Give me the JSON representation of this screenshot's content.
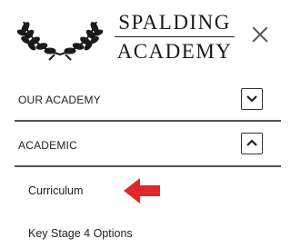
{
  "header": {
    "logo_line1": "SPALDING",
    "logo_line2": "ACADEMY",
    "logo_icon": "laurel-wreath-icon",
    "close_icon": "close-icon"
  },
  "menu": {
    "items": [
      {
        "label": "OUR ACADEMY",
        "toggle_icon": "chevron-down-icon",
        "expanded": false
      },
      {
        "label": "ACADEMIC",
        "toggle_icon": "chevron-up-icon",
        "expanded": true
      }
    ],
    "submenu": [
      {
        "label": "Curriculum",
        "highlighted": true
      },
      {
        "label": "Key Stage 4 Options"
      }
    ]
  },
  "annotation": {
    "icon": "red-arrow-icon",
    "color": "#e3262b"
  }
}
